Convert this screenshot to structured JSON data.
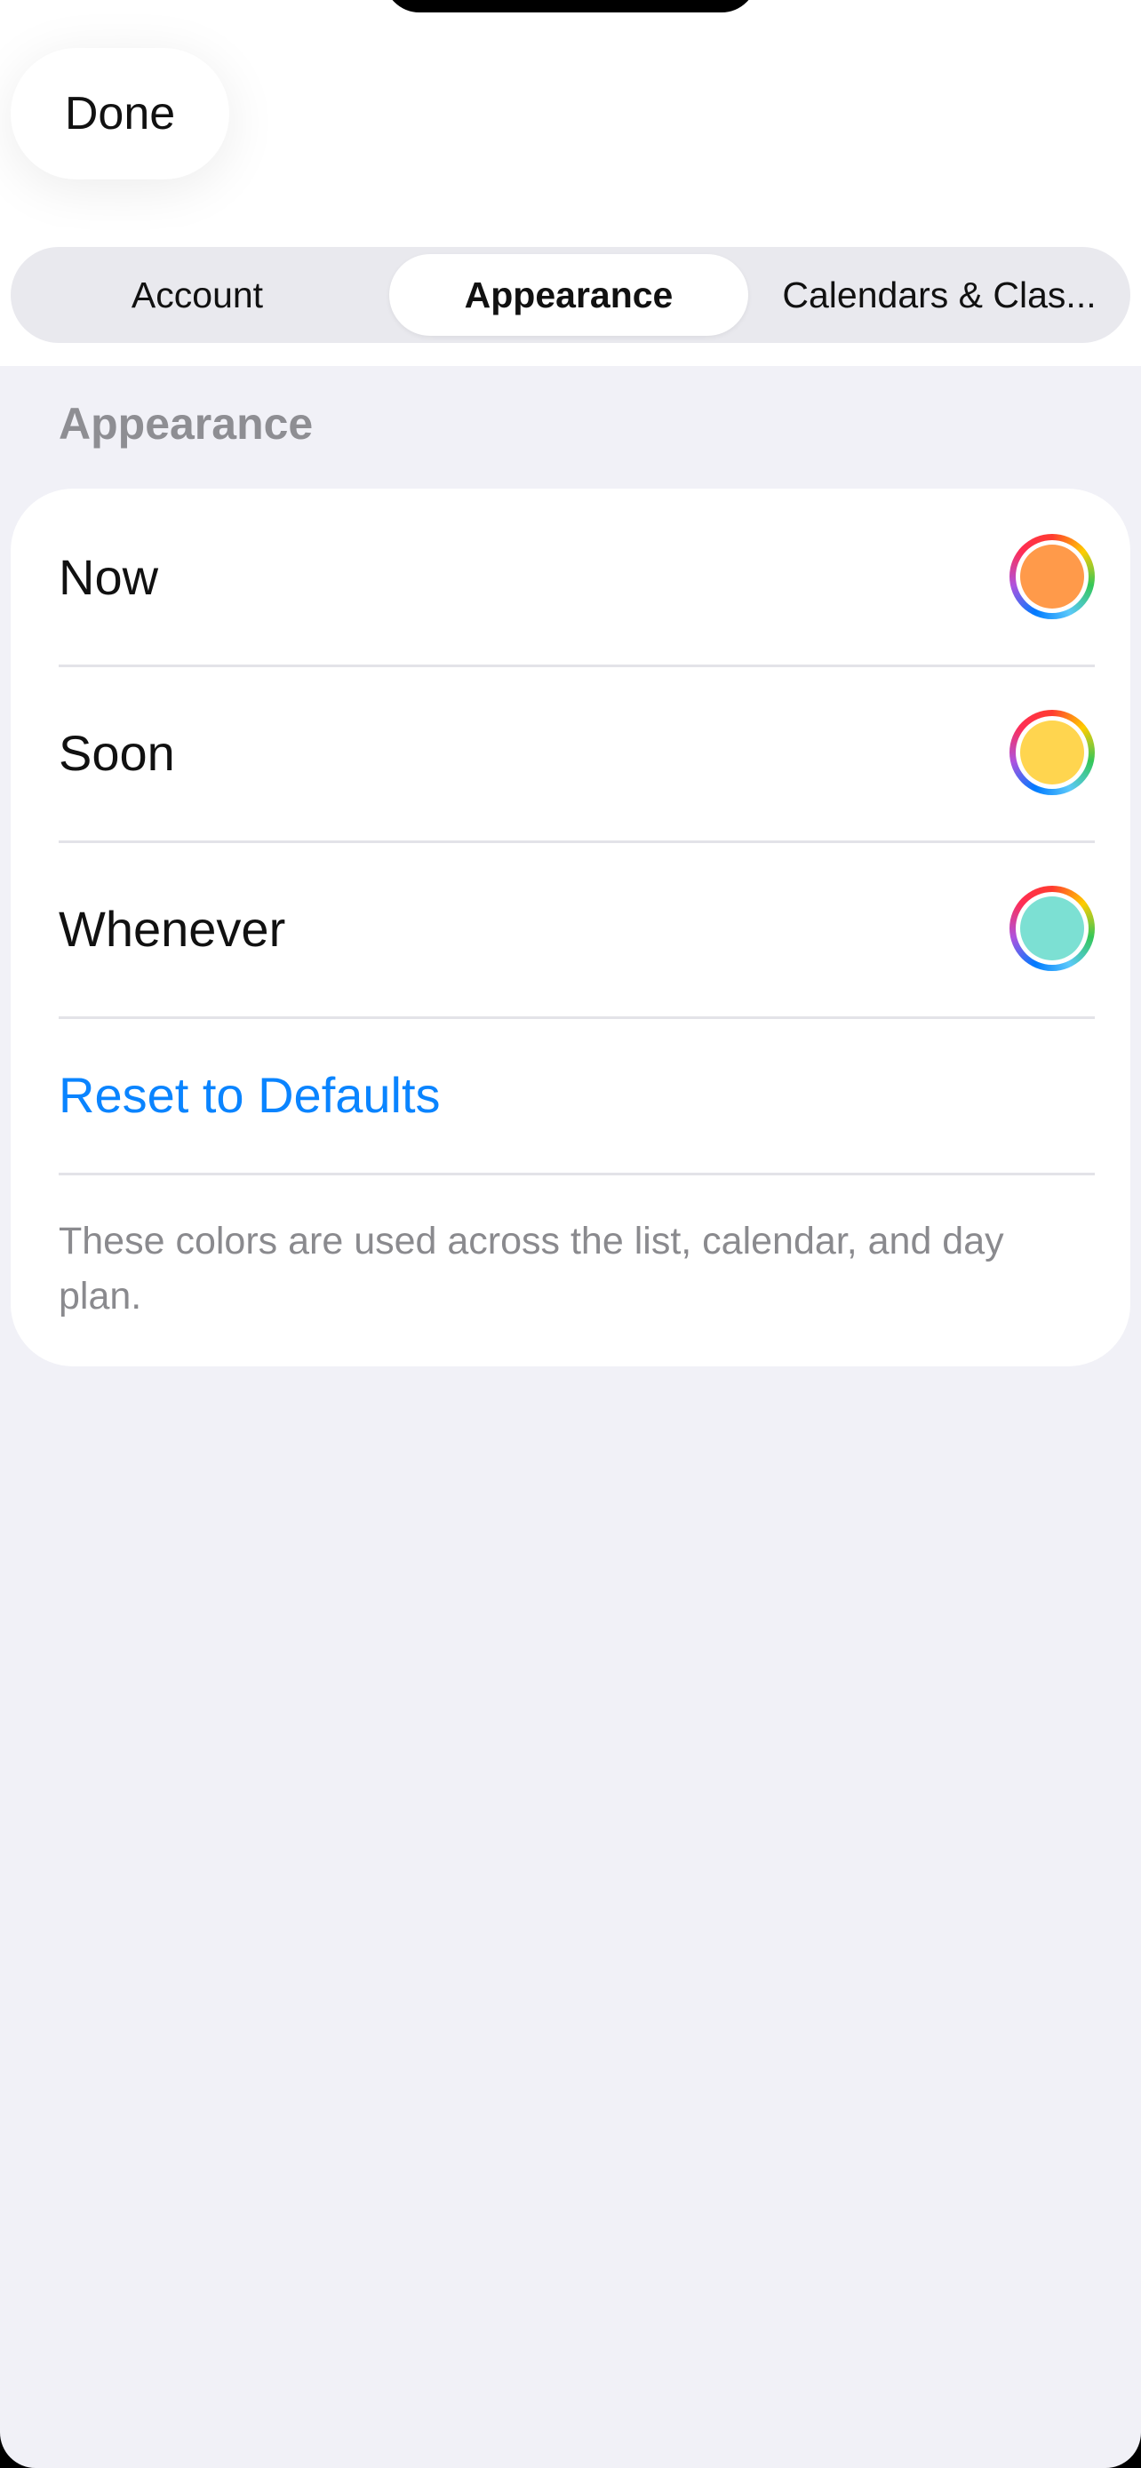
{
  "header": {
    "done_label": "Done"
  },
  "tabs": [
    {
      "label": "Account",
      "selected": false
    },
    {
      "label": "Appearance",
      "selected": true
    },
    {
      "label": "Calendars & Clas..."
    }
  ],
  "section": {
    "title": "Appearance"
  },
  "color_rows": [
    {
      "label": "Now",
      "color": "#FF9A4A"
    },
    {
      "label": "Soon",
      "color": "#FFD54F"
    },
    {
      "label": "Whenever",
      "color": "#7CE0D3"
    }
  ],
  "reset_label": "Reset to Defaults",
  "footnote": "These colors are used across the list, calendar, and day plan.",
  "colors": {
    "accent": "#0A84FF",
    "background": "#F1F1F7",
    "card": "#FFFFFF",
    "secondary_text": "#8A8A8E"
  }
}
